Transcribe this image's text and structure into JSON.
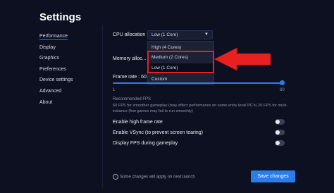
{
  "window": {
    "title": "Settings"
  },
  "sidebar": {
    "items": [
      {
        "label": "Performance"
      },
      {
        "label": "Display"
      },
      {
        "label": "Graphics"
      },
      {
        "label": "Preferences"
      },
      {
        "label": "Device settings"
      },
      {
        "label": "Advanced"
      },
      {
        "label": "About"
      }
    ]
  },
  "cpu": {
    "label": "CPU allocation",
    "selected": "Low (1 Core)",
    "options": [
      "High (4 Cores)",
      "Medium (2 Cores)",
      "Low (1 Core)",
      "Custom"
    ]
  },
  "memory": {
    "label": "Memory alloc..."
  },
  "frame_rate": {
    "label": "Frame rate : 60",
    "min_label": "1",
    "max_label": "60",
    "value": 60,
    "min": 1,
    "max": 60,
    "recommended_title": "Recommended FPS",
    "recommended_desc": "60 FPS for smoother gameplay (may effect performance on some entry level PC's) 20 FPS for multi-instance (few games may fail to run smoothly)"
  },
  "toggles": [
    {
      "label": "Enable high frame rate",
      "on": false
    },
    {
      "label": "Enable VSync (to prevent screen tearing)",
      "on": false
    },
    {
      "label": "Display FPS during gameplay",
      "on": false
    }
  ],
  "footer": {
    "note": "Some changes will apply on next launch",
    "save_label": "Save changes"
  },
  "colors": {
    "background": "#0d1021",
    "accent": "#2b7de9",
    "annotation": "#e8201f"
  }
}
